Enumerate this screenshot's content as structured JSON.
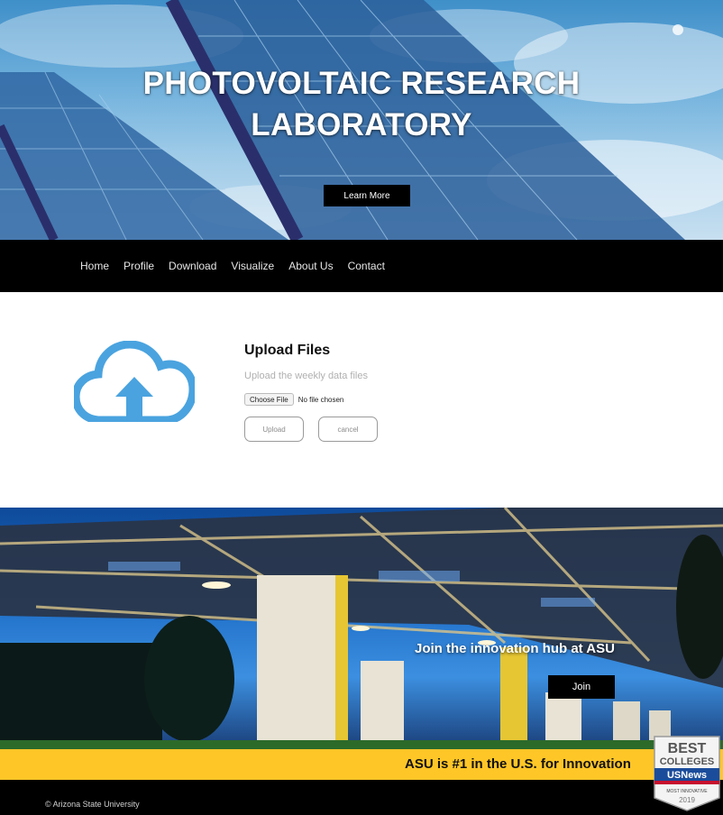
{
  "hero": {
    "title_line1": "PHOTOVOLTAIC RESEARCH",
    "title_line2": "LABORATORY",
    "learn_more_label": "Learn More"
  },
  "nav": {
    "items": [
      {
        "label": "Home"
      },
      {
        "label": "Profile"
      },
      {
        "label": "Download"
      },
      {
        "label": "Visualize"
      },
      {
        "label": "About Us"
      },
      {
        "label": "Contact"
      }
    ]
  },
  "upload": {
    "icon": "cloud-upload-icon",
    "icon_color": "#4aa3df",
    "title": "Upload Files",
    "subtitle": "Upload the weekly data files",
    "choose_file_label": "Choose File",
    "file_status": "No file chosen",
    "upload_label": "Upload",
    "cancel_label": "cancel"
  },
  "campus": {
    "headline": "Join the innovation hub at ASU",
    "join_label": "Join"
  },
  "innovation": {
    "text": "ASU is #1 in the U.S. for Innovation",
    "accent_color": "#ffc627"
  },
  "badge": {
    "line1": "BEST",
    "line2": "COLLEGES",
    "brand": "USNews",
    "subtitle": "MOST INNOVATIVE",
    "year": "2019"
  },
  "footer": {
    "copyright": "© Arizona State University"
  }
}
